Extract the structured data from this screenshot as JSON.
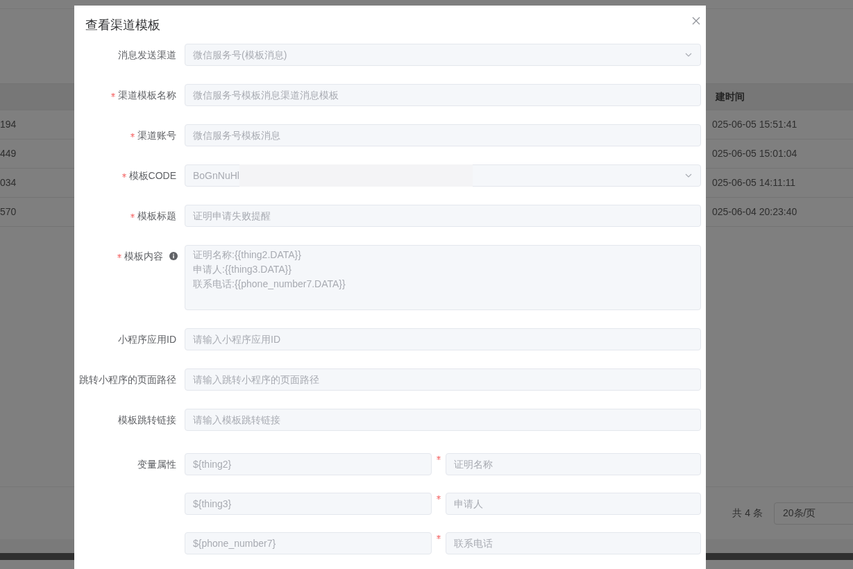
{
  "background": {
    "table": {
      "header": "建时间",
      "rows": [
        {
          "id": "194",
          "created": "025-06-05 15:51:41"
        },
        {
          "id": "449",
          "created": "025-06-05 15:01:04"
        },
        {
          "id": "034",
          "created": "025-06-05 14:11:11"
        },
        {
          "id": "570",
          "created": "025-06-04 20:23:40"
        }
      ]
    },
    "pagination": {
      "total": "共 4 条",
      "page_size": "20条/页"
    }
  },
  "dialog": {
    "title": "查看渠道模板",
    "fields": [
      {
        "label": "消息发送渠道",
        "required": false,
        "kind": "select",
        "value": "微信服务号(模板消息)"
      },
      {
        "label": "渠道模板名称",
        "required": true,
        "kind": "input",
        "value": "微信服务号模板消息渠道消息模板"
      },
      {
        "label": "渠道账号",
        "required": true,
        "kind": "input",
        "value": "微信服务号模板消息"
      },
      {
        "label": "模板CODE",
        "required": true,
        "kind": "redacted-select",
        "value": "BoGnNuHl"
      },
      {
        "label": "模板标题",
        "required": true,
        "kind": "input",
        "value": "证明申请失败提醒"
      },
      {
        "label": "模板内容",
        "required": true,
        "kind": "textarea",
        "info": true,
        "value": "证明名称:{{thing2.DATA}}\n申请人:{{thing3.DATA}}\n联系电话:{{phone_number7.DATA}}"
      },
      {
        "label": "小程序应用ID",
        "required": false,
        "kind": "input",
        "placeholder": "请输入小程序应用ID"
      },
      {
        "label": "跳转小程序的页面路径",
        "required": false,
        "kind": "input",
        "placeholder": "请输入跳转小程序的页面路径"
      },
      {
        "label": "模板跳转链接",
        "required": false,
        "kind": "input",
        "placeholder": "请输入模板跳转链接"
      }
    ],
    "variables": {
      "label": "变量属性",
      "rows": [
        {
          "key": "${thing2}",
          "name": "证明名称",
          "required": true
        },
        {
          "key": "${thing3}",
          "name": "申请人",
          "required": true
        },
        {
          "key": "${phone_number7}",
          "name": "联系电话",
          "required": true
        }
      ]
    }
  }
}
